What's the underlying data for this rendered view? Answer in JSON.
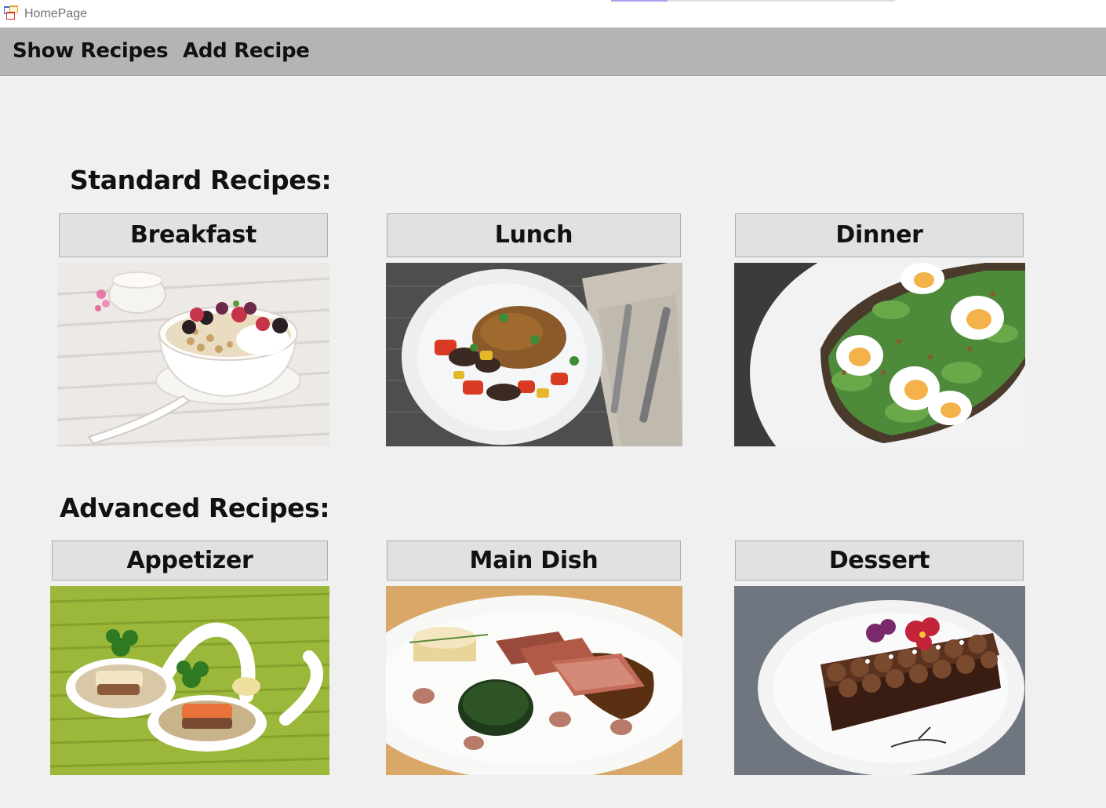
{
  "window": {
    "title": "HomePage",
    "icon": "app-window-icon"
  },
  "menu": {
    "items": [
      "Show Recipes",
      "Add Recipe"
    ]
  },
  "sections": {
    "standard": {
      "title": "Standard Recipes:",
      "categories": [
        {
          "label": "Breakfast",
          "image": "yogurt-berry-granola-bowl"
        },
        {
          "label": "Lunch",
          "image": "curry-vegetable-plate"
        },
        {
          "label": "Dinner",
          "image": "avocado-egg-toast"
        }
      ]
    },
    "advanced": {
      "title": "Advanced Recipes:",
      "categories": [
        {
          "label": "Appetizer",
          "image": "appetizer-spoons"
        },
        {
          "label": "Main Dish",
          "image": "sliced-steak-plate"
        },
        {
          "label": "Dessert",
          "image": "chocolate-brownie-dessert"
        }
      ]
    }
  }
}
